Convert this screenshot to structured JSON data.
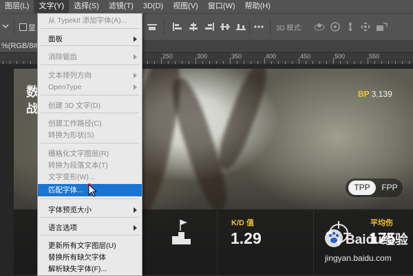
{
  "menubar": {
    "items": [
      "图层(L)",
      "文字(Y)",
      "选择(S)",
      "滤镜(T)",
      "3D(D)",
      "视图(V)",
      "窗口(W)",
      "帮助(H)"
    ]
  },
  "optionsbar": {
    "checkbox_label": "显",
    "mode_3d_label": "3D 模式:"
  },
  "doc_tab": {
    "label": "%(RGB/8#)",
    "close": "×"
  },
  "ruler": {
    "labels": [
      "250",
      "300",
      "350",
      "400",
      "450",
      "500",
      "550"
    ]
  },
  "artwork": {
    "title_fragment_1": "数",
    "title_fragment_2": "战",
    "bp_label": "BP",
    "bp_value": "3,139",
    "toggle_tpp": "TPP",
    "toggle_fpp": "FPP",
    "stat1_label": "K/D 值",
    "stat1_value": "1.29",
    "stat2_label": "平均伤",
    "stat2_value": "175",
    "watermark_brand": "Baidu经验",
    "watermark_url": "jingyan.baidu.com"
  },
  "dropdown": {
    "items": [
      {
        "label": "从 Typekit 添加字体(A)...",
        "state": "disabled",
        "submenu": false
      },
      {
        "label": "面板",
        "state": "enabled",
        "submenu": true
      },
      {
        "label": "消除锯齿",
        "state": "disabled",
        "submenu": true
      },
      {
        "label": "文本排列方向",
        "state": "disabled",
        "submenu": true
      },
      {
        "label": "OpenType",
        "state": "disabled",
        "submenu": true
      },
      {
        "label": "创建 3D 文字(D)",
        "state": "disabled",
        "submenu": false
      },
      {
        "label": "创建工作路径(C)",
        "state": "disabled",
        "submenu": false
      },
      {
        "label": "转换为形状(S)",
        "state": "disabled",
        "submenu": false
      },
      {
        "label": "栅格化文字图层(R)",
        "state": "disabled",
        "submenu": false
      },
      {
        "label": "转换为段落文本(T)",
        "state": "disabled",
        "submenu": false
      },
      {
        "label": "文字变形(W)...",
        "state": "disabled",
        "submenu": false
      },
      {
        "label": "匹配字体...",
        "state": "selected",
        "submenu": false
      },
      {
        "label": "字体预览大小",
        "state": "enabled",
        "submenu": true
      },
      {
        "label": "语言选项",
        "state": "enabled",
        "submenu": true
      },
      {
        "label": "更新所有文字图层(U)",
        "state": "enabled",
        "submenu": false
      },
      {
        "label": "替换所有缺欠字体",
        "state": "enabled",
        "submenu": false
      },
      {
        "label": "解析缺失字体(F)...",
        "state": "enabled",
        "submenu": false
      }
    ]
  },
  "colors": {
    "menu_highlight": "#1a74d2",
    "accent_yellow": "#f2c230"
  }
}
